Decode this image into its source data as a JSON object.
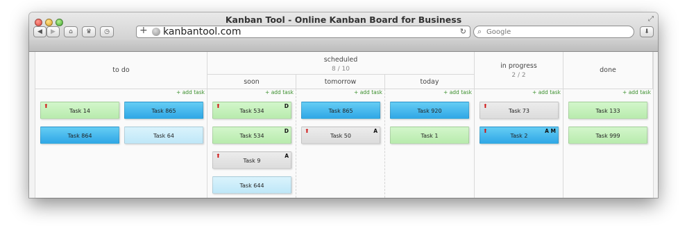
{
  "browser": {
    "title": "Kanban Tool - Online Kanban Board for Business",
    "url": "kanbantool.com",
    "search_placeholder": "Google"
  },
  "board": {
    "columns": {
      "todo": {
        "name": "to do",
        "add": "+ add task"
      },
      "scheduled": {
        "name": "scheduled",
        "wip": "8 / 10"
      },
      "soon": {
        "name": "soon",
        "add": "+ add task"
      },
      "tomorrow": {
        "name": "tomorrow",
        "add": "+ add task"
      },
      "today": {
        "name": "today",
        "add": "+ add task"
      },
      "inprogress": {
        "name": "in progress",
        "wip": "2 / 2",
        "add": "+ add task"
      },
      "done": {
        "name": "done",
        "add": "+ add task"
      }
    },
    "cards": {
      "todo": [
        "Task 14",
        "Task 865",
        "Task 864",
        "Task 64"
      ],
      "soon": [
        "Task 534",
        "Task 534",
        "Task 9",
        "Task 644"
      ],
      "soon_tags": [
        "D",
        "D",
        "A"
      ],
      "tomorrow": [
        "Task 865",
        "Task 50"
      ],
      "tomorrow_tags": [
        "A"
      ],
      "today": [
        "Task 920",
        "Task 1"
      ],
      "inprogress": [
        "Task 73",
        "Task 2"
      ],
      "inprogress_tags": [
        "A M"
      ],
      "done": [
        "Task 133",
        "Task 999"
      ]
    }
  },
  "colors": {
    "green_card": "#c6f1bd",
    "blue_card": "#3fb2ea",
    "light_blue_card": "#cdeefb",
    "gray_card": "#e3e3e3",
    "priority_arrow": "#d01010",
    "add_task_link": "#3b8f2d"
  },
  "icons": [
    "back-icon",
    "forward-icon",
    "home-icon",
    "bookmarks-icon",
    "history-icon",
    "add-tab-icon",
    "globe-icon",
    "reload-icon",
    "search-icon",
    "download-icon",
    "fullscreen-icon",
    "priority-arrow-icon"
  ]
}
